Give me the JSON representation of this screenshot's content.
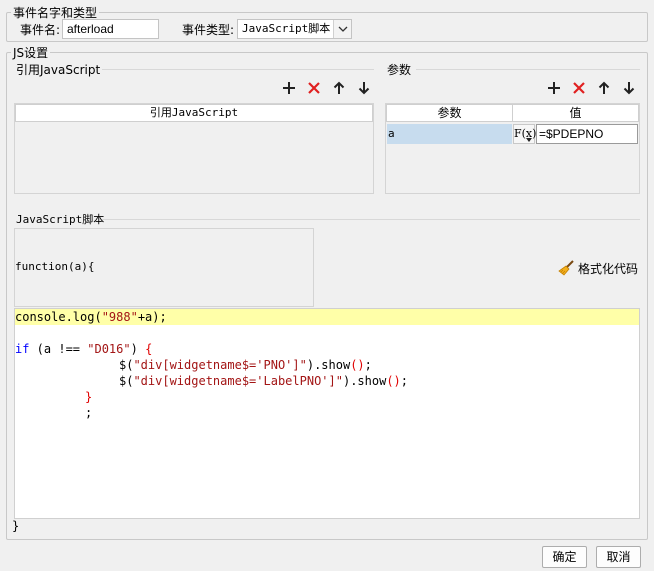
{
  "event_group": {
    "legend": "事件名字和类型",
    "name_label": "事件名:",
    "name_value": "afterload",
    "type_label": "事件类型:",
    "type_value": "JavaScript脚本"
  },
  "js_group": {
    "legend": "JS设置",
    "ref_js": {
      "section_title": "引用JavaScript",
      "column_header": "引用JavaScript",
      "rows": []
    },
    "params": {
      "section_title": "参数",
      "headers": {
        "param": "参数",
        "value": "值"
      },
      "rows": [
        {
          "param": "a",
          "fx": "F(x)",
          "value": "=$PDEPNO"
        }
      ]
    },
    "script": {
      "section_title": "JavaScript脚本",
      "signature": "function(a){",
      "format_label": "格式化代码",
      "closing": "}",
      "code_lines": [
        "console.log(\"988\"+a);",
        "",
        "if (a !== \"D016\") {",
        "\t$(\"div[widgetname$='PNO']\").show();",
        "\t$(\"div[widgetname$='LabelPNO']\").show();",
        "}",
        ";"
      ]
    }
  },
  "footer": {
    "ok": "确定",
    "cancel": "取消"
  },
  "icons": {
    "add": "plus-icon",
    "delete": "red-x-icon",
    "up": "arrow-up-icon",
    "down": "arrow-down-icon",
    "format": "broom-icon"
  },
  "colors": {
    "delete_red": "#e02020",
    "selected_cell": "#c7dcee",
    "highlight_line": "#ffffa8"
  }
}
